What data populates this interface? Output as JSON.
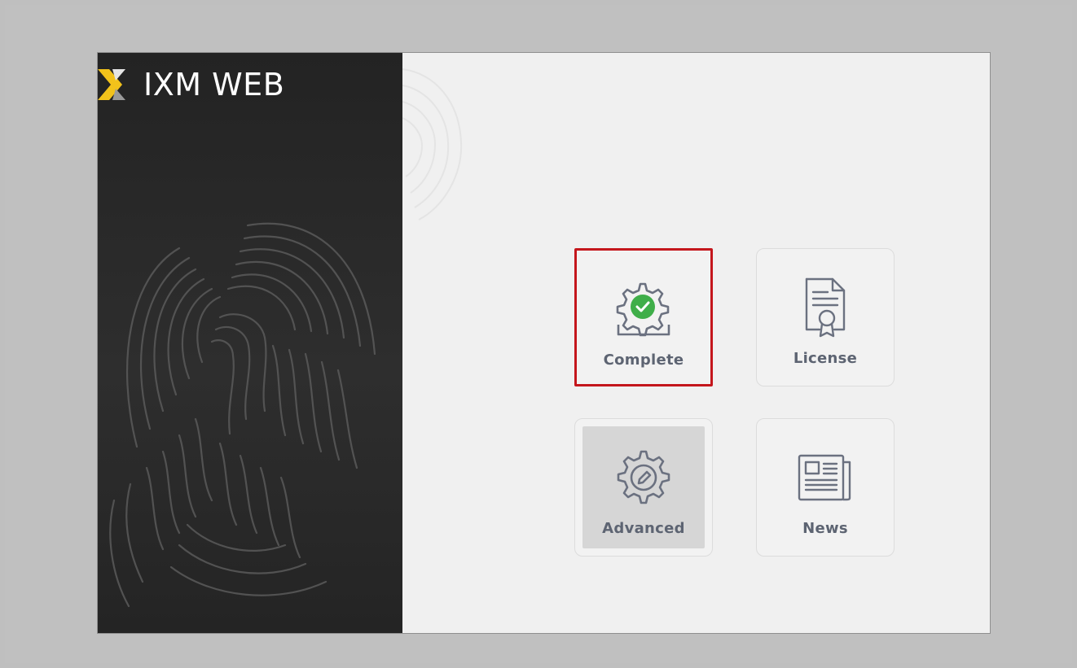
{
  "app": {
    "title": "IXM WEB"
  },
  "tiles": [
    {
      "id": "complete",
      "label": "Complete",
      "icon": "gear-check-icon",
      "selected": true
    },
    {
      "id": "license",
      "label": "License",
      "icon": "license-certificate-icon",
      "selected": false
    },
    {
      "id": "advanced",
      "label": "Advanced",
      "icon": "gear-pencil-icon",
      "selected": false,
      "pressed": true
    },
    {
      "id": "news",
      "label": "News",
      "icon": "newspaper-icon",
      "selected": false
    }
  ],
  "colors": {
    "selection_border": "#c4161c",
    "accent_green": "#3fae49",
    "logo_yellow": "#f2c21b",
    "sidebar_bg": "#2a2a2a",
    "icon_gray": "#6b7180"
  }
}
